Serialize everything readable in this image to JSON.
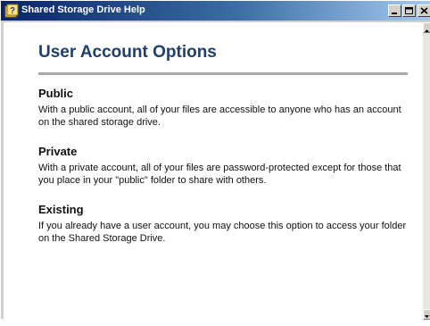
{
  "window": {
    "title": "Shared Storage Drive Help",
    "icon": "help-question-icon",
    "buttons": [
      "minimize-icon",
      "restore-icon",
      "close-icon"
    ]
  },
  "colors": {
    "titlebar_start": "#0a246a",
    "heading": "#1f3f6e",
    "rule": "#a8a8a8"
  },
  "page": {
    "title": "User Account Options",
    "sections": [
      {
        "heading": "Public",
        "body": "With a public account, all of your files are accessible to anyone who has an account on the shared storage drive."
      },
      {
        "heading": "Private",
        "body": "With a private account, all of your files are password-protected except for those that you place in your \"public\" folder to share with others."
      },
      {
        "heading": "Existing",
        "body": "If you already have a user account, you may choose this option to access your folder on the Shared Storage Drive."
      }
    ]
  }
}
